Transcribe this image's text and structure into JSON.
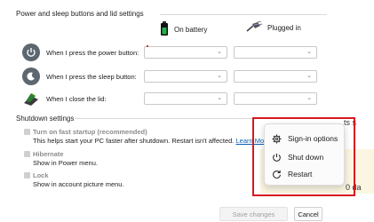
{
  "power_buttons": {
    "title": "Power and sleep buttons and lid settings",
    "col_battery": "On battery",
    "col_plugged": "Plugged in",
    "rows": [
      {
        "label": "When I press the power button:",
        "icon": "power-button-icon"
      },
      {
        "label": "When I press the sleep button:",
        "icon": "sleep-button-icon"
      },
      {
        "label": "When I close the lid:",
        "icon": "lid-close-icon"
      }
    ]
  },
  "shutdown": {
    "title": "Shutdown settings",
    "options": [
      {
        "title": "Turn on fast startup (recommended)",
        "desc": "This helps start your PC faster after shutdown. Restart isn't affected.",
        "link": "Learn More",
        "checked": false
      },
      {
        "title": "Hibernate",
        "desc": "Show in Power menu.",
        "checked": false
      },
      {
        "title": "Lock",
        "desc": "Show in account picture menu.",
        "checked": false
      }
    ]
  },
  "power_menu": {
    "items": [
      {
        "label": "Sign-in options",
        "icon": "gear-icon"
      },
      {
        "label": "Shut down",
        "icon": "power-icon"
      },
      {
        "label": "Restart",
        "icon": "restart-icon"
      }
    ]
  },
  "background_fragments": {
    "top_right": "ts s",
    "bottom_right": "0 da"
  },
  "footer": {
    "save_label": "Save changes",
    "cancel_label": "Cancel"
  },
  "colors": {
    "highlight_border": "#d71920",
    "link": "#0a5fb4"
  }
}
